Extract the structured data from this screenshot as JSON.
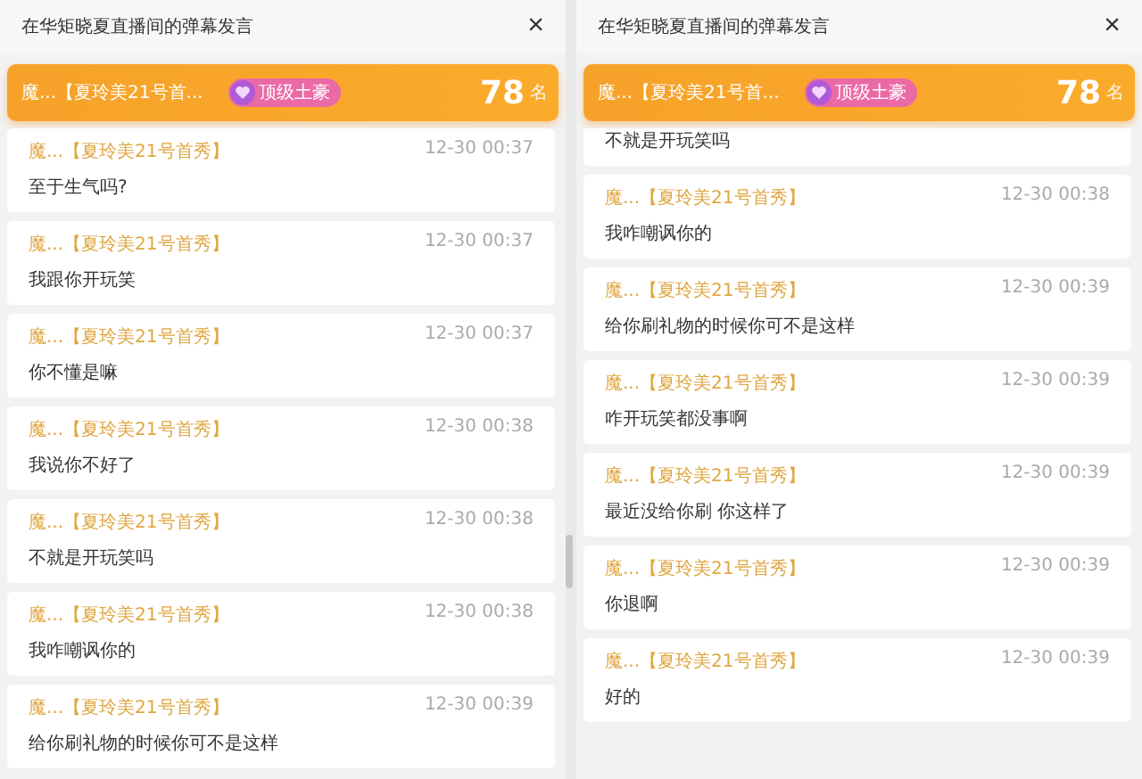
{
  "panels": [
    {
      "title": "在华矩晓夏直播间的弹幕发言",
      "close": "×",
      "banner": {
        "name": "魔...【夏玲美21号首...",
        "badge": "顶级土豪",
        "rank": "78",
        "rank_unit": "名"
      },
      "messages": [
        {
          "user": "魔...【夏玲美21号首秀】",
          "time": "12-30 00:37",
          "text": "至于生气吗?"
        },
        {
          "user": "魔...【夏玲美21号首秀】",
          "time": "12-30 00:37",
          "text": "我跟你开玩笑"
        },
        {
          "user": "魔...【夏玲美21号首秀】",
          "time": "12-30 00:37",
          "text": "你不懂是嘛"
        },
        {
          "user": "魔...【夏玲美21号首秀】",
          "time": "12-30 00:38",
          "text": "我说你不好了"
        },
        {
          "user": "魔...【夏玲美21号首秀】",
          "time": "12-30 00:38",
          "text": "不就是开玩笑吗"
        },
        {
          "user": "魔...【夏玲美21号首秀】",
          "time": "12-30 00:38",
          "text": "我咋嘲讽你的"
        },
        {
          "user": "魔...【夏玲美21号首秀】",
          "time": "12-30 00:39",
          "text": "给你刷礼物的时候你可不是这样"
        }
      ]
    },
    {
      "title": "在华矩晓夏直播间的弹幕发言",
      "close": "×",
      "banner": {
        "name": "魔...【夏玲美21号首...",
        "badge": "顶级土豪",
        "rank": "78",
        "rank_unit": "名"
      },
      "messages": [
        {
          "text": "不就是开玩笑吗"
        },
        {
          "user": "魔...【夏玲美21号首秀】",
          "time": "12-30 00:38",
          "text": "我咋嘲讽你的"
        },
        {
          "user": "魔...【夏玲美21号首秀】",
          "time": "12-30 00:39",
          "text": "给你刷礼物的时候你可不是这样"
        },
        {
          "user": "魔...【夏玲美21号首秀】",
          "time": "12-30 00:39",
          "text": "咋开玩笑都没事啊"
        },
        {
          "user": "魔...【夏玲美21号首秀】",
          "time": "12-30 00:39",
          "text": "最近没给你刷 你这样了"
        },
        {
          "user": "魔...【夏玲美21号首秀】",
          "time": "12-30 00:39",
          "text": "你退啊"
        },
        {
          "user": "魔...【夏玲美21号首秀】",
          "time": "12-30 00:39",
          "text": "好的"
        }
      ]
    }
  ]
}
